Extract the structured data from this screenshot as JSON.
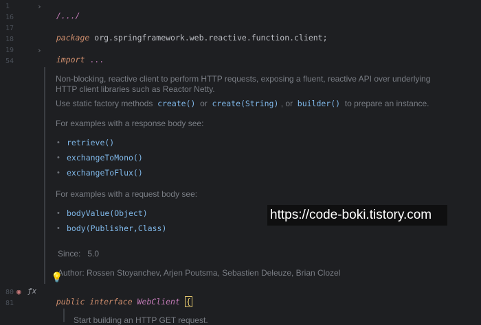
{
  "gutter": {
    "line_numbers": [
      "1",
      "16",
      "17",
      "18",
      "19",
      "54",
      "80",
      "81"
    ]
  },
  "code": {
    "line1": "/.../",
    "package_kw": "package",
    "package_name": "org.springframework.web.reactive.function.client;",
    "import_kw": "import",
    "import_rest": "...",
    "public_kw": "public",
    "interface_kw": "interface",
    "class_name": "WebClient",
    "brace": "{"
  },
  "doc": {
    "para1_line1": "Non-blocking, reactive client to perform HTTP requests, exposing a fluent, reactive API over underlying",
    "para1_line2": "HTTP client libraries such as Reactor Netty.",
    "para2_a": "Use static factory methods",
    "para2_create": "create()",
    "para2_or1": "or",
    "para2_create_str": "create(String)",
    "para2_or2": ", or",
    "para2_builder": "builder()",
    "para2_b": "to prepare an instance.",
    "resp_heading": "For examples with a response body see:",
    "resp_items": [
      "retrieve()",
      "exchangeToMono()",
      "exchangeToFlux()"
    ],
    "req_heading": "For examples with a request body see:",
    "req_items": [
      "bodyValue(Object)",
      "body(Publisher,Class)"
    ],
    "since_label": "Since:",
    "since_value": "5.0",
    "author_label": "Author:",
    "author_value": "Rossen Stoyanchev, Arjen Poutsma, Sebastien Deleuze, Brian Clozel",
    "next_doc": "Start building an HTTP GET request."
  },
  "watermark": "https://code-boki.tistory.com",
  "colors": {
    "background": "#1e1f22",
    "keyword": "#cf8e6d",
    "doc_text": "#7a7e85",
    "doc_link": "#7fb7e8"
  }
}
